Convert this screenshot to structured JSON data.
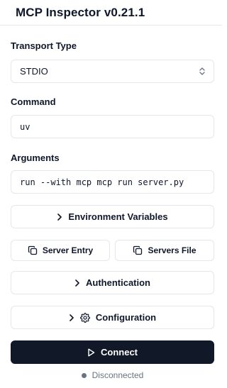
{
  "app": {
    "title": "MCP Inspector v0.21.1"
  },
  "transport": {
    "label": "Transport Type",
    "value": "STDIO"
  },
  "command": {
    "label": "Command",
    "value": "uv"
  },
  "arguments": {
    "label": "Arguments",
    "value": "run --with mcp mcp run server.py"
  },
  "buttons": {
    "env_vars": "Environment Variables",
    "server_entry": "Server Entry",
    "servers_file": "Servers File",
    "authentication": "Authentication",
    "configuration": "Configuration",
    "connect": "Connect"
  },
  "status": {
    "text": "Disconnected",
    "dot_color": "#6b7280"
  },
  "icons": {
    "select": "chevron-up-down-icon",
    "expand": "chevron-right-icon",
    "copy": "copy-icon",
    "settings": "gear-icon",
    "connect": "play-icon"
  }
}
